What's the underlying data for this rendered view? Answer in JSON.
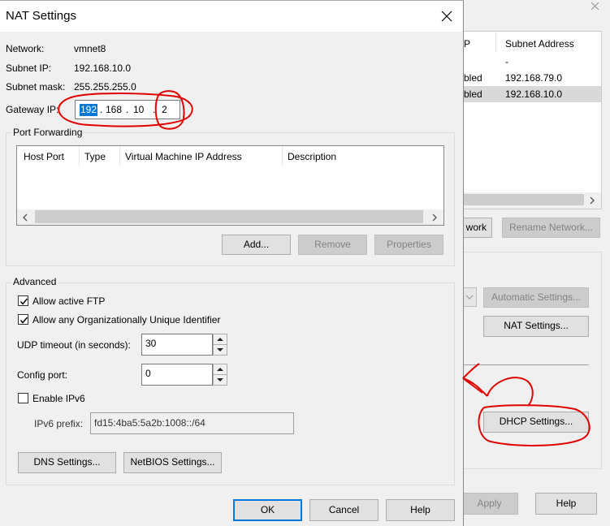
{
  "dialog": {
    "title": "NAT Settings",
    "network_label": "Network:",
    "network_value": "vmnet8",
    "subnet_ip_label": "Subnet IP:",
    "subnet_ip_value": "192.168.10.0",
    "subnet_mask_label": "Subnet mask:",
    "subnet_mask_value": "255.255.255.0",
    "gateway_label": "Gateway IP:",
    "gateway_octets": [
      "192",
      "168",
      "10",
      "2"
    ],
    "port_forwarding": {
      "label": "Port Forwarding",
      "columns": [
        "Host Port",
        "Type",
        "Virtual Machine IP Address",
        "Description"
      ],
      "add_label": "Add...",
      "remove_label": "Remove",
      "properties_label": "Properties"
    },
    "advanced": {
      "label": "Advanced",
      "allow_ftp_label": "Allow active FTP",
      "allow_ftp_checked": true,
      "allow_oui_label": "Allow any Organizationally Unique Identifier",
      "allow_oui_checked": true,
      "udp_timeout_label": "UDP timeout (in seconds):",
      "udp_timeout_value": "30",
      "config_port_label": "Config port:",
      "config_port_value": "0",
      "enable_ipv6_label": "Enable IPv6",
      "enable_ipv6_checked": false,
      "ipv6_prefix_label": "IPv6 prefix:",
      "ipv6_prefix_value": "fd15:4ba5:5a2b:1008::/64",
      "dns_settings_label": "DNS Settings...",
      "netbios_settings_label": "NetBIOS Settings..."
    },
    "ok_label": "OK",
    "cancel_label": "Cancel",
    "help_label": "Help"
  },
  "background_window": {
    "columns": [
      "P",
      "Subnet Address"
    ],
    "rows": [
      {
        "status": "",
        "subnet": "-"
      },
      {
        "status": "bled",
        "subnet": "192.168.79.0"
      },
      {
        "status": "bled",
        "subnet": "192.168.10.0"
      }
    ],
    "network_btn_partial": "work",
    "rename_network_label": "Rename Network...",
    "automatic_settings_label": "Automatic Settings...",
    "nat_settings_label": "NAT Settings...",
    "dhcp_settings_label": "DHCP Settings...",
    "apply_label": "Apply",
    "help_label": "Help"
  },
  "colors": {
    "selection": "#0078d7",
    "annotation": "#e00000",
    "default_button_border": "#0078d7"
  }
}
